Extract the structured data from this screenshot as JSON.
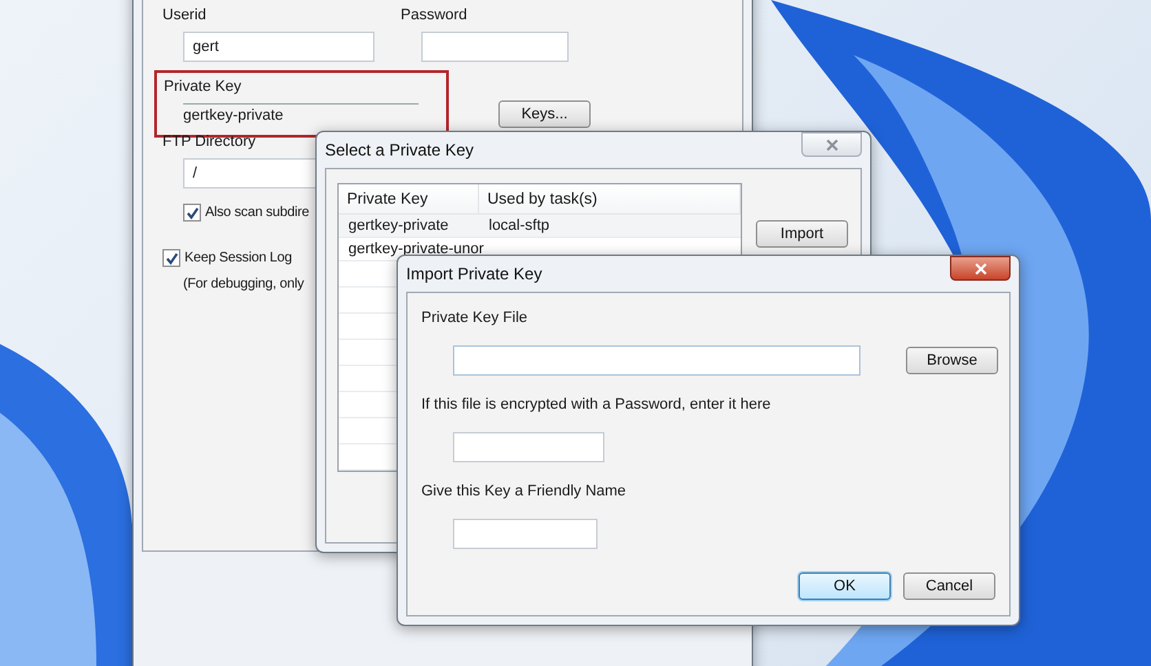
{
  "main_window": {
    "userid": {
      "label": "Userid",
      "value": "gert"
    },
    "password": {
      "label": "Password"
    },
    "private_key": {
      "label": "Private Key",
      "value": "gertkey-private",
      "highlighted": true
    },
    "keys_button": "Keys...",
    "ftp_directory": {
      "label": "FTP Directory",
      "value": "/"
    },
    "options": [
      {
        "label": "Also scan subdire",
        "checked": true
      },
      {
        "label": "Keep Session Log",
        "checked": true
      }
    ],
    "log_note": "(For debugging, only"
  },
  "select_dialog": {
    "title": "Select a Private Key",
    "columns": [
      "Private Key",
      "Used by task(s)"
    ],
    "rows": [
      {
        "cells": [
          "gertkey-private",
          "local-sftp"
        ]
      },
      {
        "cells": [
          "gertkey-private-unor"
        ]
      }
    ],
    "import_button": "Import"
  },
  "import_dialog": {
    "title": "Import Private Key",
    "fields": [
      {
        "label": "Private Key File",
        "kind": "file"
      },
      {
        "label": "If this file is encrypted with a Password, enter it here",
        "kind": "password"
      },
      {
        "label": "Give this Key a Friendly Name",
        "kind": "name"
      }
    ],
    "browse_button": "Browse",
    "buttons": [
      {
        "label": "OK",
        "default": true
      },
      {
        "label": "Cancel",
        "default": false
      }
    ]
  }
}
